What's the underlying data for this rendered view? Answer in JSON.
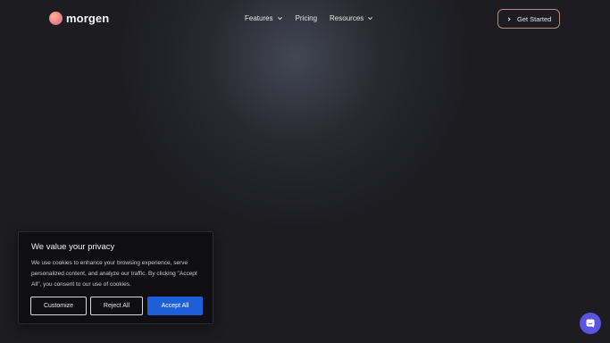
{
  "brand": {
    "name": "morgen"
  },
  "nav": {
    "items": [
      {
        "label": "Features",
        "has_dropdown": true
      },
      {
        "label": "Pricing",
        "has_dropdown": false
      },
      {
        "label": "Resources",
        "has_dropdown": true
      }
    ],
    "cta_label": "Get Started"
  },
  "cookie_banner": {
    "title": "We value your privacy",
    "body": "We use cookies to enhance your browsing experience, serve personalized content, and analyze our traffic. By clicking \"Accept All\", you consent to our use of cookies.",
    "customize_label": "Customize",
    "reject_label": "Reject All",
    "accept_label": "Accept All"
  },
  "colors": {
    "background": "#1c1c21",
    "accent_button": "#1e5fd8",
    "chat_button": "#5a55e0",
    "cta_border": "#b58c7c"
  },
  "icons": {
    "chat": "chat-bubble-icon",
    "cta": "chevron-right-icon",
    "dropdown": "chevron-down-icon"
  }
}
